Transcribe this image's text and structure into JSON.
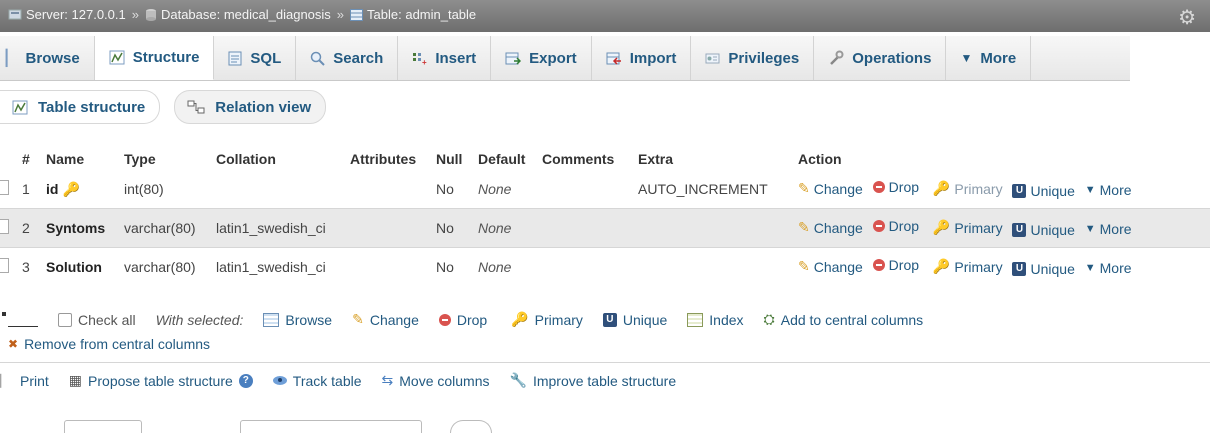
{
  "breadcrumb": {
    "server": "Server: 127.0.0.1",
    "database": "Database: medical_diagnosis",
    "table": "Table: admin_table",
    "separator": "»"
  },
  "tabs": [
    {
      "label": "Browse",
      "icon": "browse-icon"
    },
    {
      "label": "Structure",
      "icon": "structure-icon",
      "active": true
    },
    {
      "label": "SQL",
      "icon": "sql-icon"
    },
    {
      "label": "Search",
      "icon": "search-icon"
    },
    {
      "label": "Insert",
      "icon": "insert-icon"
    },
    {
      "label": "Export",
      "icon": "export-icon"
    },
    {
      "label": "Import",
      "icon": "import-icon"
    },
    {
      "label": "Privileges",
      "icon": "privileges-icon"
    },
    {
      "label": "Operations",
      "icon": "wrench-icon"
    },
    {
      "label": "More",
      "icon": "chevron-down-icon"
    }
  ],
  "subtabs": {
    "table_structure": "Table structure",
    "relation_view": "Relation view"
  },
  "table": {
    "headers": {
      "num": "#",
      "name": "Name",
      "type": "Type",
      "collation": "Collation",
      "attributes": "Attributes",
      "null": "Null",
      "default": "Default",
      "comments": "Comments",
      "extra": "Extra",
      "action": "Action"
    },
    "rows": [
      {
        "num": "1",
        "name": "id",
        "type": "int(80)",
        "collation": "",
        "null": "No",
        "default": "None",
        "extra": "AUTO_INCREMENT"
      },
      {
        "num": "2",
        "name": "Syntoms",
        "type": "varchar(80)",
        "collation": "latin1_swedish_ci",
        "null": "No",
        "default": "None",
        "extra": ""
      },
      {
        "num": "3",
        "name": "Solution",
        "type": "varchar(80)",
        "collation": "latin1_swedish_ci",
        "null": "No",
        "default": "None",
        "extra": ""
      }
    ],
    "actions": {
      "change": "Change",
      "drop": "Drop",
      "primary": "Primary",
      "unique": "Unique",
      "more": "More"
    }
  },
  "with_selected": {
    "check_all": "Check all",
    "label": "With selected:",
    "browse": "Browse",
    "change": "Change",
    "drop": "Drop",
    "primary": "Primary",
    "unique": "Unique",
    "index": "Index",
    "add_central": "Add to central columns",
    "remove_central": "Remove from central columns"
  },
  "tools": {
    "print": "Print",
    "propose": "Propose table structure",
    "track": "Track table",
    "move": "Move columns",
    "improve": "Improve table structure"
  },
  "colors": {
    "link": "#235a81",
    "titlebar": "#7d7d7d",
    "row_alt": "#e9e9e9",
    "drop_red": "#d9534f",
    "key_gold": "#d9a12a"
  }
}
